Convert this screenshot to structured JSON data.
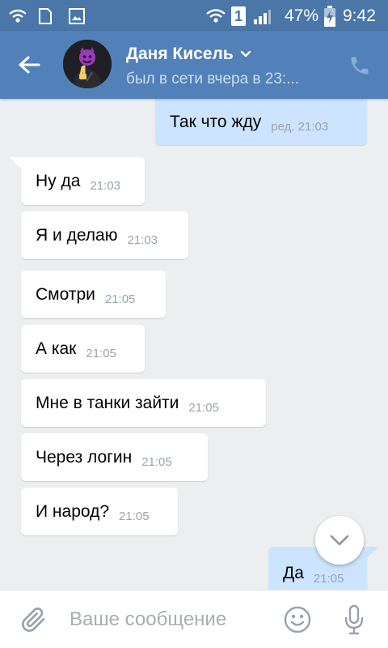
{
  "status_bar": {
    "sim_indicator": "1",
    "battery": "47%",
    "time": "9:42"
  },
  "header": {
    "contact_name": "Даня Кисель",
    "last_seen": "был в сети вчера в 23:..."
  },
  "messages": [
    {
      "direction": "out",
      "text": "Так что жду",
      "time": "ред. 21:03"
    },
    {
      "direction": "in",
      "text": "Ну да",
      "time": "21:03"
    },
    {
      "direction": "in",
      "text": "Я и делаю",
      "time": "21:03"
    },
    {
      "direction": "in",
      "text": "Смотри",
      "time": "21:05"
    },
    {
      "direction": "in",
      "text": "А как",
      "time": "21:05"
    },
    {
      "direction": "in",
      "text": "Мне в танки зайти",
      "time": "21:05"
    },
    {
      "direction": "in",
      "text": "Через логин",
      "time": "21:05"
    },
    {
      "direction": "in",
      "text": "И народ?",
      "time": "21:05"
    },
    {
      "direction": "out",
      "text": "Да",
      "time": "21:05"
    }
  ],
  "composer": {
    "placeholder": "Ваше сообщение"
  },
  "icons": {
    "back": "arrow-left-icon",
    "dropdown": "chevron-down-icon",
    "call": "phone-icon",
    "scroll": "chevron-down-icon",
    "attach": "paperclip-icon",
    "emoji": "smiley-icon",
    "voice": "microphone-icon"
  },
  "colors": {
    "header": "#5181b8",
    "status_bar": "#4a76a8",
    "chat_background": "#edeef0",
    "incoming_bubble": "#ffffff",
    "outgoing_bubble": "#cce4ff"
  }
}
